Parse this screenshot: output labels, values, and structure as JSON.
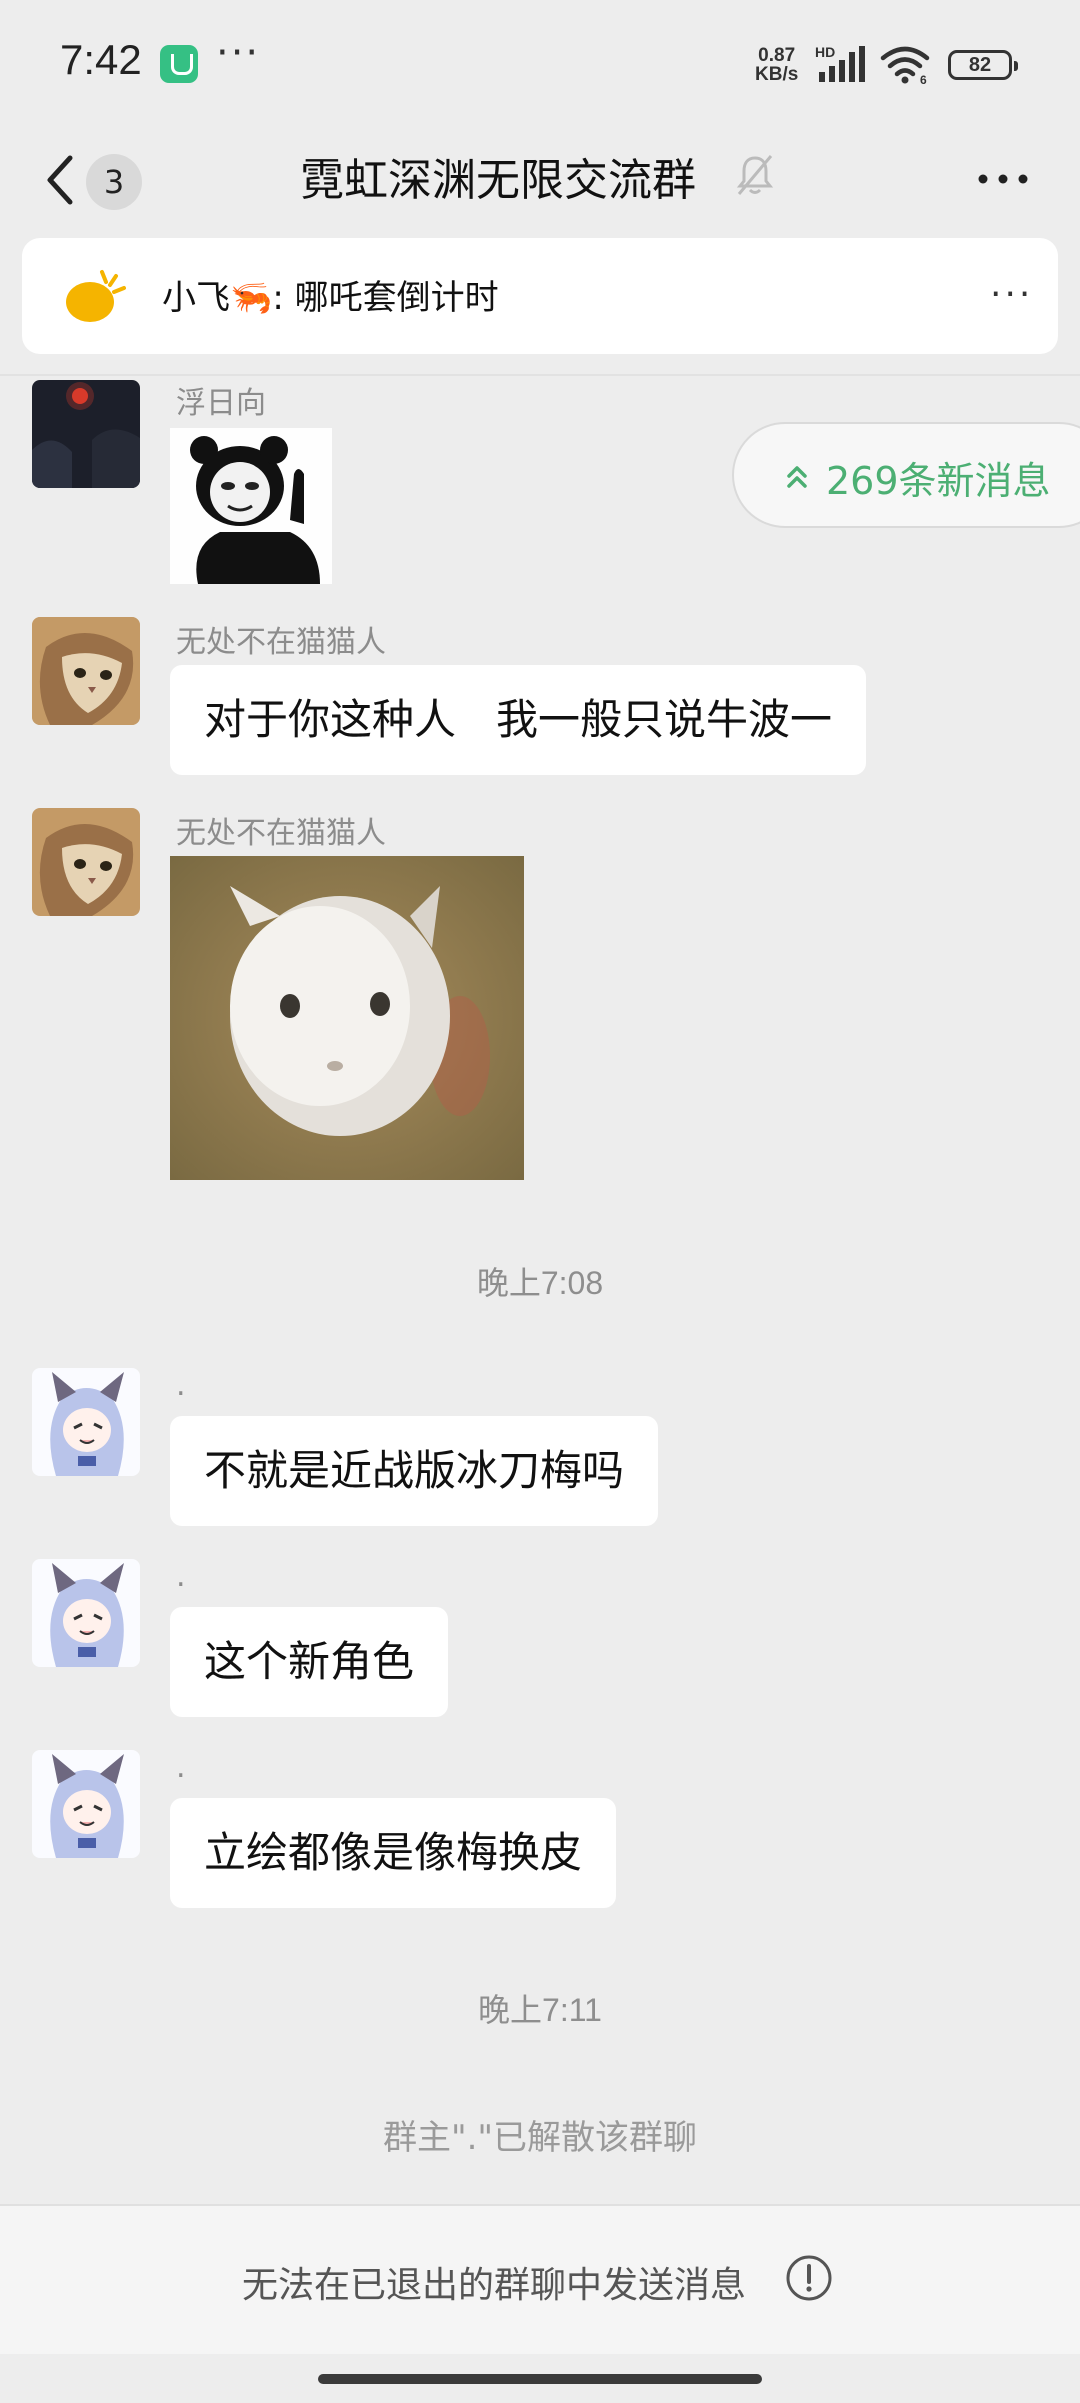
{
  "status_bar": {
    "time": "7:42",
    "more": "···",
    "net_speed_value": "0.87",
    "net_speed_unit": "KB/s",
    "hd_label": "HD",
    "wifi_label": "6",
    "battery": "82"
  },
  "header": {
    "unread_count": "3",
    "title": "霓虹深渊无限交流群"
  },
  "pinned": {
    "text": "小飞🦐: 哪吒套倒计时",
    "more": "..."
  },
  "new_messages": {
    "label": "269条新消息",
    "accent": "#4caf73"
  },
  "messages": [
    {
      "sender": "浮日向",
      "type": "sticker",
      "sticker": "panda-meme"
    },
    {
      "sender": "无处不在猫猫人",
      "type": "text",
      "text": "对于你这种人   我一般只说牛波一"
    },
    {
      "sender": "无处不在猫猫人",
      "type": "sticker",
      "sticker": "blurry-cat"
    },
    {
      "sender": ".",
      "type": "text",
      "text": "不就是近战版冰刀梅吗"
    },
    {
      "sender": ".",
      "type": "text",
      "text": "这个新角色"
    },
    {
      "sender": ".",
      "type": "text",
      "text": "立绘都像是像梅换皮"
    }
  ],
  "timestamps": [
    "晚上7:08",
    "晚上7:11"
  ],
  "system_message": "群主\".\"已解散该群聊",
  "footer": {
    "text": "无法在已退出的群聊中发送消息"
  }
}
